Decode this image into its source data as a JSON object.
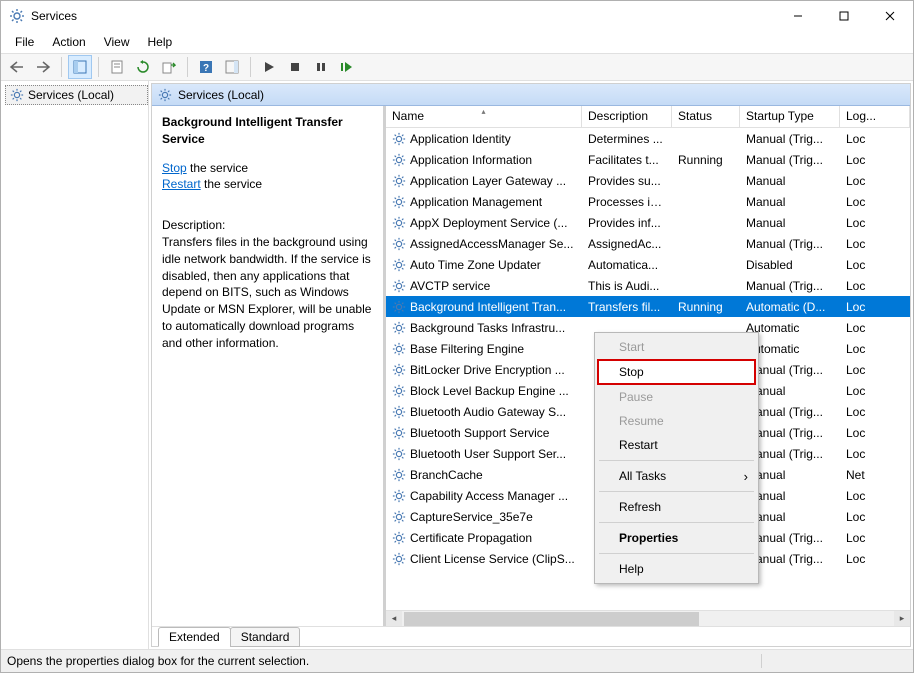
{
  "window": {
    "title": "Services"
  },
  "menubar": [
    "File",
    "Action",
    "View",
    "Help"
  ],
  "tree": {
    "root_label": "Services (Local)"
  },
  "main_header": "Services (Local)",
  "detail": {
    "service_name": "Background Intelligent Transfer Service",
    "stop_link": "Stop",
    "stop_suffix": " the service",
    "restart_link": "Restart",
    "restart_suffix": " the service",
    "desc_label": "Description:",
    "desc_text": "Transfers files in the background using idle network bandwidth. If the service is disabled, then any applications that depend on BITS, such as Windows Update or MSN Explorer, will be unable to automatically download programs and other information."
  },
  "columns": {
    "name": "Name",
    "description": "Description",
    "status": "Status",
    "startup": "Startup Type",
    "logon": "Log..."
  },
  "services": [
    {
      "name": "Application Identity",
      "desc": "Determines ...",
      "status": "",
      "startup": "Manual (Trig...",
      "logon": "Loc"
    },
    {
      "name": "Application Information",
      "desc": "Facilitates t...",
      "status": "Running",
      "startup": "Manual (Trig...",
      "logon": "Loc"
    },
    {
      "name": "Application Layer Gateway ...",
      "desc": "Provides su...",
      "status": "",
      "startup": "Manual",
      "logon": "Loc"
    },
    {
      "name": "Application Management",
      "desc": "Processes in...",
      "status": "",
      "startup": "Manual",
      "logon": "Loc"
    },
    {
      "name": "AppX Deployment Service (...",
      "desc": "Provides inf...",
      "status": "",
      "startup": "Manual",
      "logon": "Loc"
    },
    {
      "name": "AssignedAccessManager Se...",
      "desc": "AssignedAc...",
      "status": "",
      "startup": "Manual (Trig...",
      "logon": "Loc"
    },
    {
      "name": "Auto Time Zone Updater",
      "desc": "Automatica...",
      "status": "",
      "startup": "Disabled",
      "logon": "Loc"
    },
    {
      "name": "AVCTP service",
      "desc": "This is Audi...",
      "status": "",
      "startup": "Manual (Trig...",
      "logon": "Loc"
    },
    {
      "name": "Background Intelligent Tran...",
      "desc": "Transfers fil...",
      "status": "Running",
      "startup": "Automatic (D...",
      "logon": "Loc",
      "selected": true
    },
    {
      "name": "Background Tasks Infrastru...",
      "desc": "",
      "status": "",
      "startup": "Automatic",
      "logon": "Loc"
    },
    {
      "name": "Base Filtering Engine",
      "desc": "",
      "status": "",
      "startup": "Automatic",
      "logon": "Loc"
    },
    {
      "name": "BitLocker Drive Encryption ...",
      "desc": "",
      "status": "",
      "startup": "Manual (Trig...",
      "logon": "Loc"
    },
    {
      "name": "Block Level Backup Engine ...",
      "desc": "",
      "status": "",
      "startup": "Manual",
      "logon": "Loc"
    },
    {
      "name": "Bluetooth Audio Gateway S...",
      "desc": "",
      "status": "",
      "startup": "Manual (Trig...",
      "logon": "Loc"
    },
    {
      "name": "Bluetooth Support Service",
      "desc": "",
      "status": "",
      "startup": "Manual (Trig...",
      "logon": "Loc"
    },
    {
      "name": "Bluetooth User Support Ser...",
      "desc": "",
      "status": "",
      "startup": "Manual (Trig...",
      "logon": "Loc"
    },
    {
      "name": "BranchCache",
      "desc": "",
      "status": "",
      "startup": "Manual",
      "logon": "Net"
    },
    {
      "name": "Capability Access Manager ...",
      "desc": "",
      "status": "",
      "startup": "Manual",
      "logon": "Loc"
    },
    {
      "name": "CaptureService_35e7e",
      "desc": "",
      "status": "",
      "startup": "Manual",
      "logon": "Loc"
    },
    {
      "name": "Certificate Propagation",
      "desc": "",
      "status": "",
      "startup": "Manual (Trig...",
      "logon": "Loc"
    },
    {
      "name": "Client License Service (ClipS...",
      "desc": "",
      "status": "",
      "startup": "Manual (Trig...",
      "logon": "Loc"
    }
  ],
  "context_menu": [
    {
      "label": "Start",
      "disabled": true
    },
    {
      "label": "Stop",
      "highlight": true
    },
    {
      "label": "Pause",
      "disabled": true
    },
    {
      "label": "Resume",
      "disabled": true
    },
    {
      "label": "Restart"
    },
    {
      "sep": true
    },
    {
      "label": "All Tasks",
      "submenu": true
    },
    {
      "sep": true
    },
    {
      "label": "Refresh"
    },
    {
      "sep": true
    },
    {
      "label": "Properties",
      "bold": true
    },
    {
      "sep": true
    },
    {
      "label": "Help"
    }
  ],
  "tabs": {
    "extended": "Extended",
    "standard": "Standard"
  },
  "statusbar": "Opens the properties dialog box for the current selection."
}
